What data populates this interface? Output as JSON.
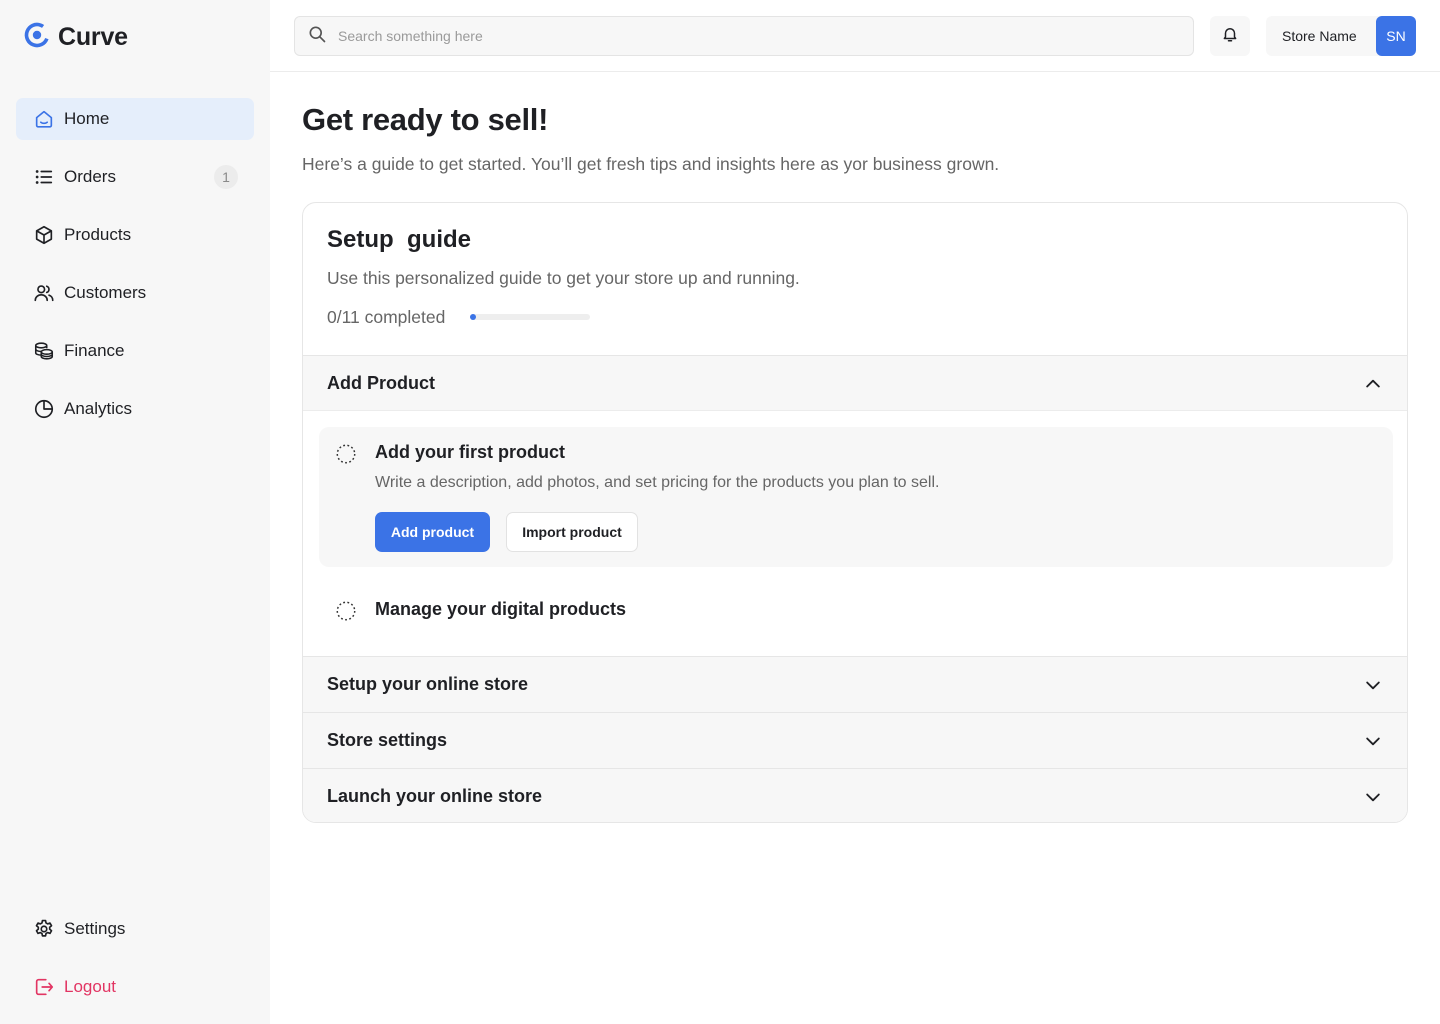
{
  "app": {
    "name": "Curve",
    "brand_color": "#3b73e6"
  },
  "sidebar": {
    "items": [
      {
        "label": "Home",
        "icon": "home-icon",
        "active": true
      },
      {
        "label": "Orders",
        "icon": "list-icon",
        "badge": "1"
      },
      {
        "label": "Products",
        "icon": "box-icon"
      },
      {
        "label": "Customers",
        "icon": "users-icon"
      },
      {
        "label": "Finance",
        "icon": "coins-icon"
      },
      {
        "label": "Analytics",
        "icon": "pie-chart-icon"
      }
    ],
    "bottom": [
      {
        "label": "Settings",
        "icon": "gear-icon"
      },
      {
        "label": "Logout",
        "icon": "logout-icon",
        "color": "#e23563"
      }
    ]
  },
  "header": {
    "search_placeholder": "Search something here",
    "store_name": "Store Name",
    "avatar_initials": "SN"
  },
  "main": {
    "title": "Get ready to sell!",
    "subtitle": "Here’s a guide to get started. You’ll get fresh tips and insights here as yor business grown."
  },
  "guide": {
    "title": "Setup  guide",
    "subtitle": "Use this personalized guide to get your store up and running.",
    "progress_label": "0/11 completed",
    "progress_fraction": 0,
    "sections": [
      {
        "label": "Add Product",
        "expanded": true,
        "tasks": [
          {
            "title": "Add your first product",
            "description": "Write a description, add photos, and set pricing for the products you plan to sell.",
            "primary_action": "Add product",
            "secondary_action": "Import product"
          },
          {
            "title": "Manage your digital products"
          }
        ]
      },
      {
        "label": "Setup your online store",
        "expanded": false
      },
      {
        "label": "Store settings",
        "expanded": false
      },
      {
        "label": "Launch your online store",
        "expanded": false
      }
    ]
  }
}
